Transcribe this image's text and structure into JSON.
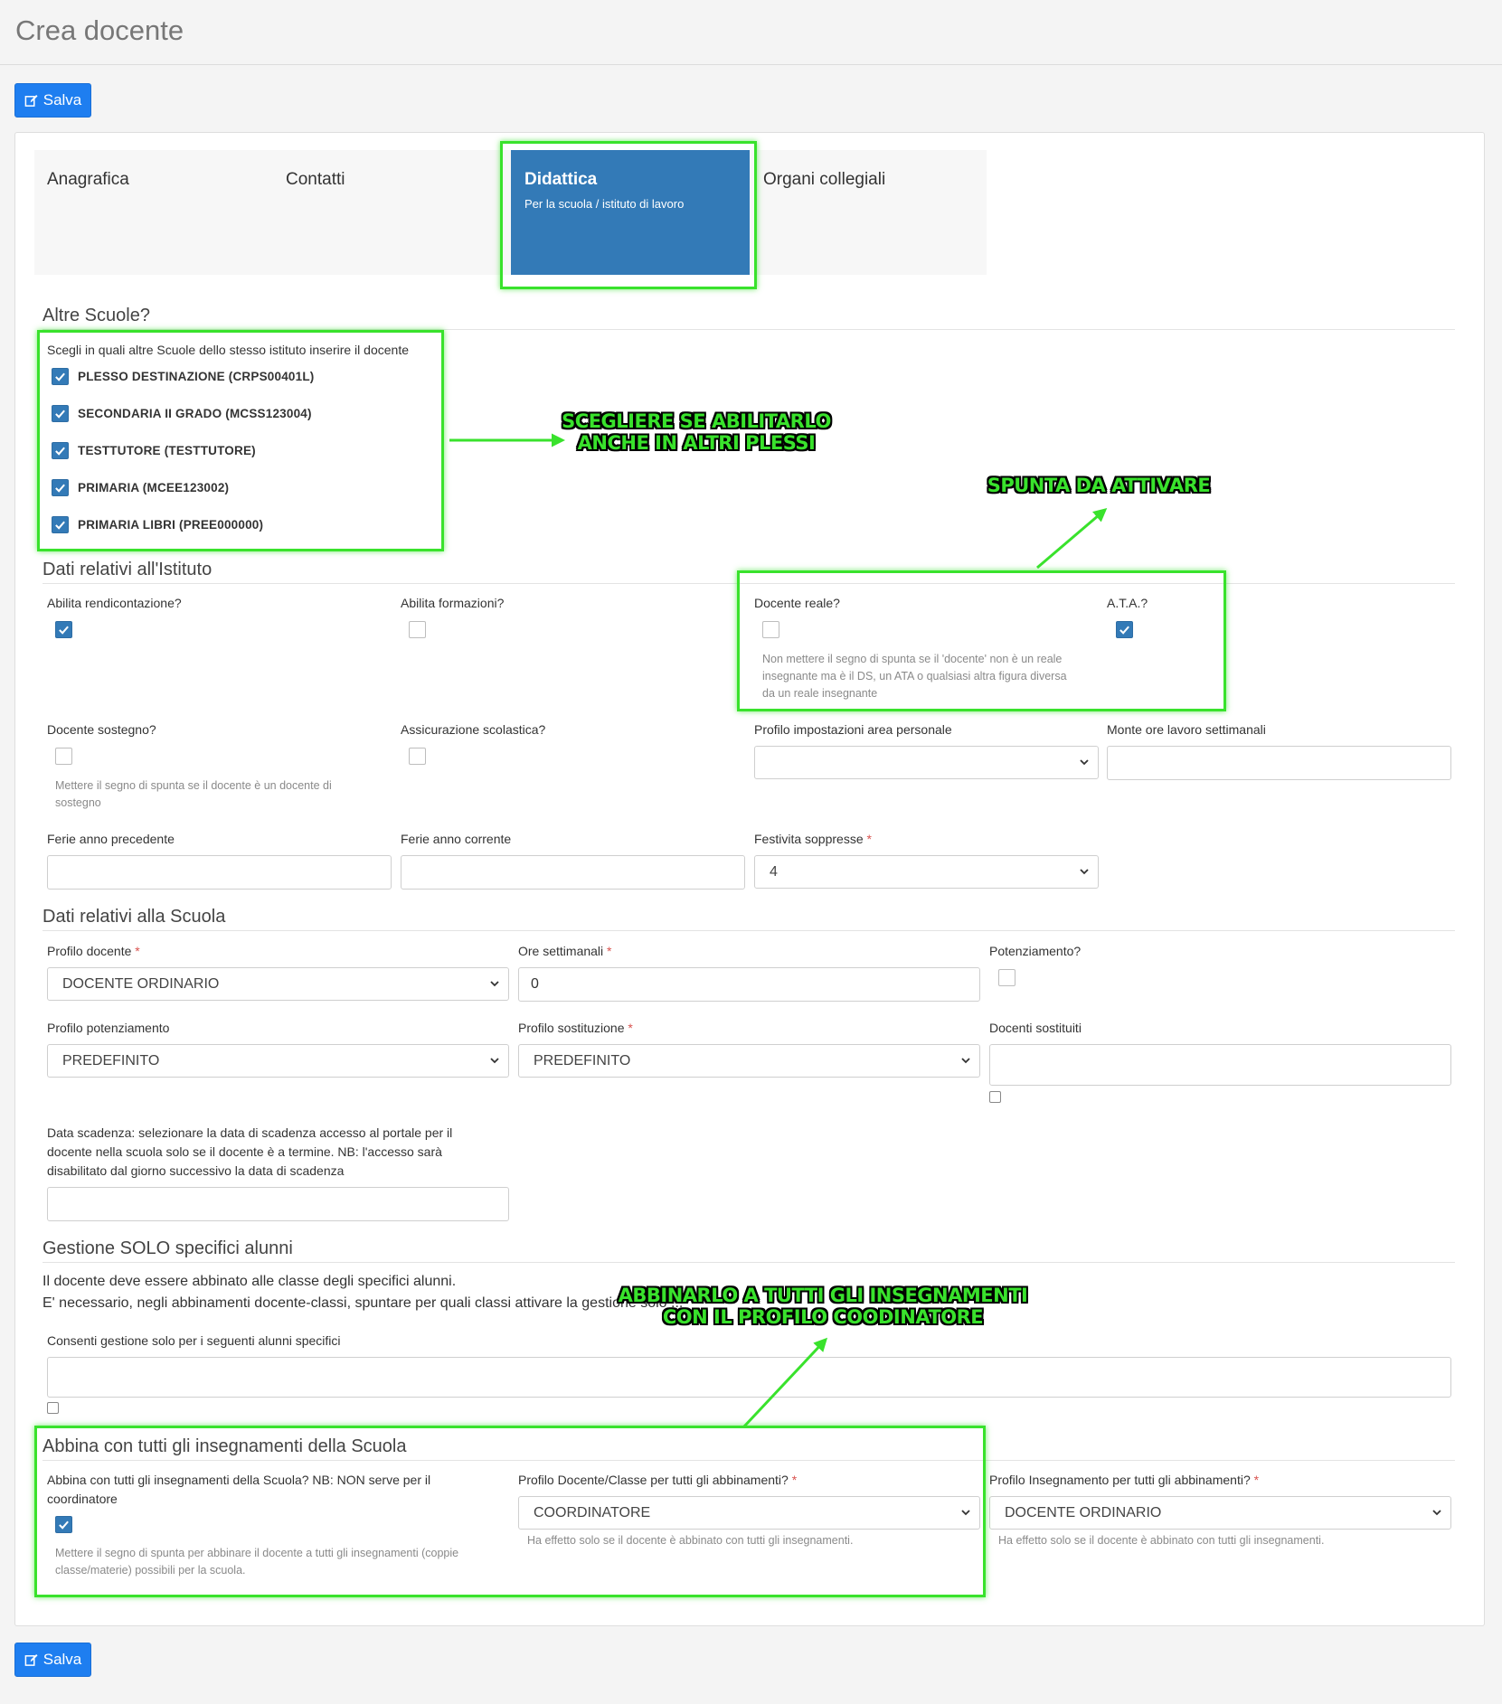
{
  "page": {
    "title": "Crea docente"
  },
  "toolbar": {
    "save_label": "Salva"
  },
  "tabs": [
    {
      "label": "Anagrafica"
    },
    {
      "label": "Contatti"
    },
    {
      "label": "Didattica",
      "subtitle": "Per la scuola / istituto di lavoro",
      "active": true
    },
    {
      "label": "Organi collegiali"
    }
  ],
  "altre_scuole": {
    "title": "Altre Scuole?",
    "prompt": "Scegli in quali altre Scuole dello stesso istituto inserire il docente",
    "schools": [
      {
        "label": "PLESSO DESTINAZIONE (CRPS00401L)",
        "checked": true
      },
      {
        "label": "SECONDARIA II GRADO (MCSS123004)",
        "checked": true
      },
      {
        "label": "TESTTUTORE (TESTTUTORE)",
        "checked": true
      },
      {
        "label": "PRIMARIA (MCEE123002)",
        "checked": true
      },
      {
        "label": "PRIMARIA LIBRI (PREE000000)",
        "checked": true
      }
    ]
  },
  "istituto": {
    "title": "Dati relativi all'Istituto",
    "abilita_rendicontazione": {
      "label": "Abilita rendicontazione?",
      "checked": true
    },
    "abilita_formazioni": {
      "label": "Abilita formazioni?",
      "checked": false
    },
    "docente_reale": {
      "label": "Docente reale?",
      "checked": false,
      "help": [
        "Non mettere il segno di spunta se il 'docente' non è un reale",
        "insegnante ma è il DS, un ATA o qualsiasi altra figura diversa",
        "da un reale insegnante"
      ]
    },
    "ata": {
      "label": "A.T.A.?",
      "checked": true
    },
    "docente_sostegno": {
      "label": "Docente sostegno?",
      "checked": false,
      "help": [
        "Mettere il segno di spunta se il docente è un docente di",
        "sostegno"
      ]
    },
    "assicurazione": {
      "label": "Assicurazione scolastica?",
      "checked": false
    },
    "profilo_impostazioni": {
      "label": "Profilo impostazioni area personale",
      "value": ""
    },
    "monte_ore": {
      "label": "Monte ore lavoro settimanali",
      "value": ""
    },
    "ferie_precedente": {
      "label": "Ferie anno precedente",
      "value": ""
    },
    "ferie_corrente": {
      "label": "Ferie anno corrente",
      "value": ""
    },
    "festivita": {
      "label": "Festivita soppresse",
      "required": "*",
      "value": "4"
    }
  },
  "scuola": {
    "title": "Dati relativi alla Scuola",
    "profilo_docente": {
      "label": "Profilo docente",
      "required": "*",
      "value": "DOCENTE ORDINARIO"
    },
    "ore_settimanali": {
      "label": "Ore settimanali",
      "required": "*",
      "value": "0"
    },
    "potenziamento": {
      "label": "Potenziamento?",
      "checked": false
    },
    "profilo_potenziamento": {
      "label": "Profilo potenziamento",
      "value": "PREDEFINITO"
    },
    "profilo_sostituzione": {
      "label": "Profilo sostituzione",
      "required": "*",
      "value": "PREDEFINITO"
    },
    "docenti_sostituiti": {
      "label": "Docenti sostituiti",
      "value": ""
    },
    "data_scadenza": {
      "label": [
        "Data scadenza: selezionare la data di scadenza accesso al portale per il",
        "docente nella scuola solo se il docente è a termine. NB: l'accesso sarà",
        "disabilitato dal giorno successivo la data di scadenza"
      ],
      "value": ""
    }
  },
  "gestione": {
    "title": "Gestione SOLO specifici alunni",
    "text1": "Il docente deve essere abbinato alle classe degli specifici alunni.",
    "text2": "E' necessario, negli abbinamenti docente-classi, spuntare per quali classi attivare la gestione solo ...",
    "consenti": {
      "label": "Consenti gestione solo per i seguenti alunni specifici",
      "value": ""
    }
  },
  "abbina": {
    "title": "Abbina con tutti gli insegnamenti della Scuola",
    "question": [
      "Abbina con tutti gli insegnamenti della Scuola? NB: NON serve per il",
      "coordinatore"
    ],
    "checked": true,
    "help": [
      "Mettere il segno di spunta per abbinare il docente a tutti gli insegnamenti (coppie",
      "classe/materie) possibili per la scuola."
    ],
    "profilo_docente_classe": {
      "label": "Profilo Docente/Classe per tutti gli abbinamenti?",
      "required": "*",
      "value": "COORDINATORE",
      "help": "Ha effetto solo se il docente è abbinato con tutti gli insegnamenti."
    },
    "profilo_insegnamento": {
      "label": "Profilo Insegnamento per tutti gli abbinamenti?",
      "required": "*",
      "value": "DOCENTE ORDINARIO",
      "help": "Ha effetto solo se il docente è abbinato con tutti gli insegnamenti."
    }
  },
  "annotations": {
    "altri_plessi": [
      "SCEGLIERE SE ABILITARLO",
      "ANCHE IN ALTRI PLESSI"
    ],
    "spunta": [
      "SPUNTA DA ATTIVARE"
    ],
    "coordinatore": [
      "ABBINARLO A TUTTI GLI INSEGNAMENTI",
      "CON IL PROFILO COODINATORE"
    ]
  },
  "colors": {
    "primary": "#1e7ef0",
    "tab_active": "#337ab7",
    "highlight": "#39e22c",
    "required": "#d9534f"
  },
  "icons": {
    "save": "edit-icon",
    "check": "checkmark-icon",
    "select": "chevron-down-icon"
  }
}
